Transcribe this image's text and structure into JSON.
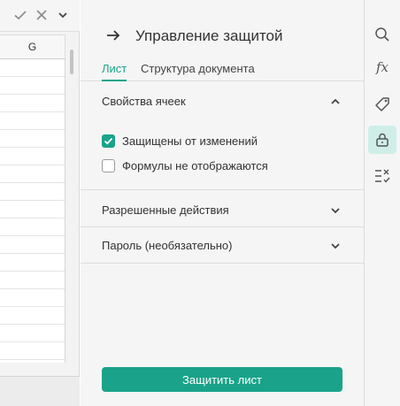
{
  "sheet": {
    "column_header": "G"
  },
  "panel": {
    "title": "Управление защитой",
    "tabs": [
      {
        "label": "Лист",
        "active": true
      },
      {
        "label": "Структура документа",
        "active": false
      }
    ],
    "cell_properties": {
      "title": "Свойства ячеек",
      "expanded": true,
      "options": [
        {
          "label": "Защищены от изменений",
          "checked": true
        },
        {
          "label": "Формулы не отображаются",
          "checked": false
        }
      ]
    },
    "allowed_actions": {
      "title": "Разрешенные действия",
      "expanded": false
    },
    "password": {
      "title": "Пароль (необязательно)",
      "expanded": false
    },
    "protect_button": "Защитить лист"
  },
  "toolbar": {
    "items": [
      {
        "icon": "search-icon"
      },
      {
        "icon": "function-icon",
        "glyph": "fx"
      },
      {
        "icon": "tag-icon"
      },
      {
        "icon": "lock-icon",
        "active": true
      },
      {
        "icon": "checklist-icon"
      }
    ]
  },
  "colors": {
    "accent": "#1aa38a",
    "active_tool_bg": "#cfeee7",
    "panel_bg": "#f5f5f5"
  }
}
